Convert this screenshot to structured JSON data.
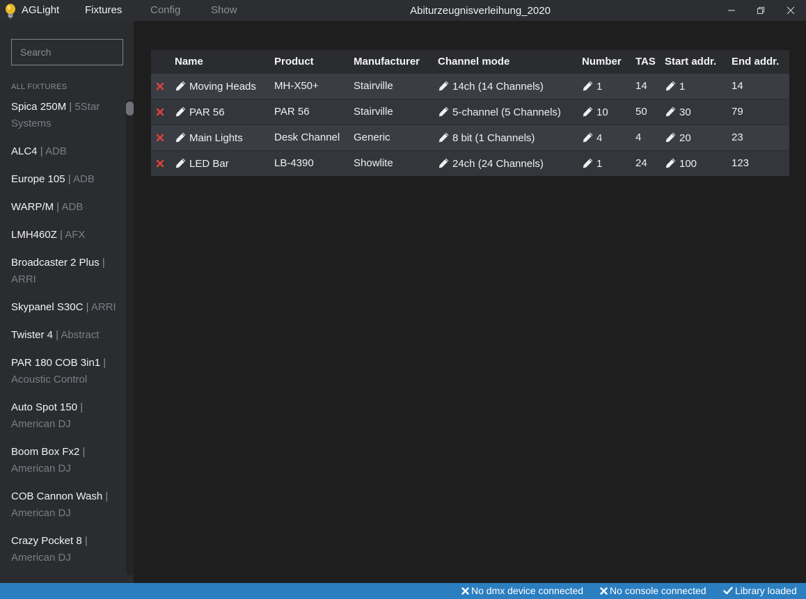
{
  "app": {
    "name": "AGLight"
  },
  "menu": {
    "fixtures": "Fixtures",
    "config": "Config",
    "show": "Show"
  },
  "window": {
    "title": "Abiturzeugnisverleihung_2020"
  },
  "sidebar": {
    "search_placeholder": "Search",
    "section_label": "ALL FIXTURES",
    "items": [
      {
        "name": "Spica 250M",
        "manufacturer": "5Star Systems"
      },
      {
        "name": "ALC4",
        "manufacturer": "ADB"
      },
      {
        "name": "Europe 105",
        "manufacturer": "ADB"
      },
      {
        "name": "WARP/M",
        "manufacturer": "ADB"
      },
      {
        "name": "LMH460Z",
        "manufacturer": "AFX"
      },
      {
        "name": "Broadcaster 2 Plus",
        "manufacturer": "ARRI"
      },
      {
        "name": "Skypanel S30C",
        "manufacturer": "ARRI"
      },
      {
        "name": "Twister 4",
        "manufacturer": "Abstract"
      },
      {
        "name": "PAR 180 COB 3in1",
        "manufacturer": "Acoustic Control"
      },
      {
        "name": "Auto Spot 150",
        "manufacturer": "American DJ"
      },
      {
        "name": "Boom Box Fx2",
        "manufacturer": "American DJ"
      },
      {
        "name": "COB Cannon Wash",
        "manufacturer": "American DJ"
      },
      {
        "name": "Crazy Pocket 8",
        "manufacturer": "American DJ"
      }
    ]
  },
  "table": {
    "headers": {
      "name": "Name",
      "product": "Product",
      "manufacturer": "Manufacturer",
      "channel_mode": "Channel mode",
      "number": "Number",
      "tas": "TAS",
      "start": "Start addr.",
      "end": "End addr."
    },
    "rows": [
      {
        "name": "Moving Heads",
        "product": "MH-X50+",
        "manufacturer": "Stairville",
        "channel_mode": "14ch (14 Channels)",
        "number": "1",
        "tas": "14",
        "start": "1",
        "end": "14"
      },
      {
        "name": "PAR 56",
        "product": "PAR 56",
        "manufacturer": "Stairville",
        "channel_mode": "5-channel (5 Channels)",
        "number": "10",
        "tas": "50",
        "start": "30",
        "end": "79"
      },
      {
        "name": "Main Lights",
        "product": "Desk Channel",
        "manufacturer": "Generic",
        "channel_mode": "8 bit (1 Channels)",
        "number": "4",
        "tas": "4",
        "start": "20",
        "end": "23"
      },
      {
        "name": "LED Bar",
        "product": "LB-4390",
        "manufacturer": "Showlite",
        "channel_mode": "24ch (24 Channels)",
        "number": "1",
        "tas": "24",
        "start": "100",
        "end": "123"
      }
    ]
  },
  "status": {
    "dmx": "No dmx device connected",
    "console": "No console connected",
    "library": "Library loaded"
  },
  "colors": {
    "accent": "#2b7fc1",
    "delete": "#d9443b",
    "titlebar": "#2c2e31",
    "sidebar": "#2a2c2f"
  }
}
